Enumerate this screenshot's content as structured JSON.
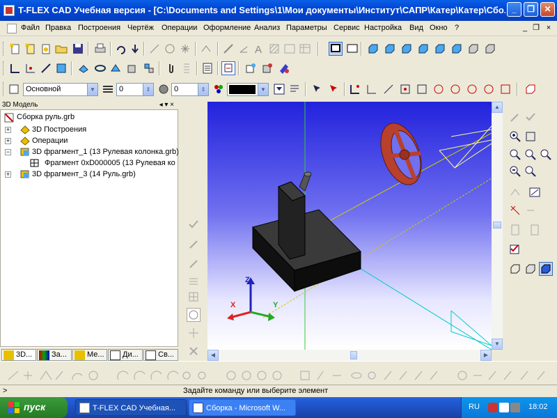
{
  "window": {
    "title": "T-FLEX CAD Учебная версия - [C:\\Documents and Settings\\1\\Мои документы\\Институт\\САПР\\Катер\\Катер\\Сбо...",
    "min": "_",
    "max": "❐",
    "close": "✕"
  },
  "menu": {
    "items": [
      "Файл",
      "Правка",
      "Построения",
      "Чертёж",
      "Операции",
      "Оформление",
      "Анализ",
      "Параметры",
      "Сервис",
      "Настройка",
      "Вид",
      "Окно",
      "?"
    ],
    "mdi_min": "_",
    "mdi_restore": "❐",
    "mdi_close": "×"
  },
  "toolbar3": {
    "layer": "Основной",
    "line_width": "0",
    "level": "0"
  },
  "panel": {
    "header": "3D Модель",
    "hdr_controls": "◂ ▾ ×",
    "tree": [
      {
        "label": "Сборка руль.grb"
      },
      {
        "label": "3D Построения"
      },
      {
        "label": "Операции"
      },
      {
        "label": "3D фрагмент_1 (13 Рулевая колонка.grb)"
      },
      {
        "label": "Фрагмент 0xD000005 (13 Рулевая ко"
      },
      {
        "label": "3D фрагмент_3 (14 Руль.grb)"
      }
    ],
    "tabs": [
      "3D...",
      "За...",
      "Ме...",
      "Ди...",
      "Св..."
    ]
  },
  "viewport": {
    "axis_x": "X",
    "axis_y": "Y",
    "axis_z": "Z",
    "bg_top": "#2222dd",
    "bg_bottom": "#ffffff",
    "wheel_color": "#b8402c",
    "body_color": "#1e1e1e"
  },
  "status": {
    "left": ">",
    "message": "Задайте команду или выберите элемент"
  },
  "taskbar": {
    "start": "пуск",
    "tasks": [
      "T-FLEX CAD Учебная...",
      "Сборка - Microsoft W..."
    ],
    "lang": "RU",
    "clock": "18:02"
  }
}
